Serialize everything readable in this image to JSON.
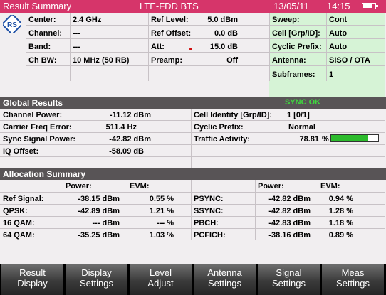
{
  "header": {
    "title": "Result Summary",
    "mode": "LTE-FDD BTS",
    "date": "13/05/11",
    "time": "14:15"
  },
  "settings": {
    "center_label": "Center:",
    "center_value": "2.4 GHz",
    "channel_label": "Channel:",
    "channel_value": "---",
    "band_label": "Band:",
    "band_value": "---",
    "chbw_label": "Ch BW:",
    "chbw_value": "10 MHz (50 RB)",
    "reflevel_label": "Ref Level:",
    "reflevel_value": "5.0 dBm",
    "refoffset_label": "Ref Offset:",
    "refoffset_value": "0.0 dB",
    "att_label": "Att:",
    "att_value": "15.0 dB",
    "preamp_label": "Preamp:",
    "preamp_value": "Off",
    "sweep_label": "Sweep:",
    "sweep_value": "Cont",
    "cell_label": "Cell [Grp/ID]:",
    "cell_value": "Auto",
    "cp_label": "Cyclic Prefix:",
    "cp_value": "Auto",
    "antenna_label": "Antenna:",
    "antenna_value": "SISO / OTA",
    "subframes_label": "Subframes:",
    "subframes_value": "1"
  },
  "global": {
    "heading": "Global Results",
    "sync_status": "SYNC OK",
    "channel_power_label": "Channel Power:",
    "channel_power_value": "-11.12 dBm",
    "carrier_freq_label": "Carrier Freq Error:",
    "carrier_freq_value": "511.4 Hz",
    "sync_signal_label": "Sync Signal Power:",
    "sync_signal_value": "-42.82 dBm",
    "iq_offset_label": "IQ Offset:",
    "iq_offset_value": "-58.09 dB",
    "cell_identity_label": "Cell Identity [Grp/ID]:",
    "cell_identity_value": "1  [0/1]",
    "cyclic_prefix_label": "Cyclic Prefix:",
    "cyclic_prefix_value": "Normal",
    "traffic_label": "Traffic Activity:",
    "traffic_value": "78.81",
    "traffic_unit": "%",
    "traffic_percent": 78.81
  },
  "allocation": {
    "heading": "Allocation Summary",
    "col_power": "Power:",
    "col_evm": "EVM:",
    "left_rows": [
      {
        "name": "Ref Signal:",
        "power": "-38.15 dBm",
        "evm": "0.55 %"
      },
      {
        "name": "QPSK:",
        "power": "-42.89 dBm",
        "evm": "1.21 %"
      },
      {
        "name": "16 QAM:",
        "power": "--- dBm",
        "evm": "--- %"
      },
      {
        "name": "64 QAM:",
        "power": "-35.25 dBm",
        "evm": "1.03 %"
      }
    ],
    "right_rows": [
      {
        "name": "PSYNC:",
        "power": "-42.82 dBm",
        "evm": "0.94 %"
      },
      {
        "name": "SSYNC:",
        "power": "-42.82 dBm",
        "evm": "1.28 %"
      },
      {
        "name": "PBCH:",
        "power": "-42.83 dBm",
        "evm": "1.18 %"
      },
      {
        "name": "PCFICH:",
        "power": "-38.16 dBm",
        "evm": "0.89 %"
      }
    ]
  },
  "softkeys": [
    {
      "line1": "Result",
      "line2": "Display"
    },
    {
      "line1": "Display",
      "line2": "Settings"
    },
    {
      "line1": "Level",
      "line2": "Adjust"
    },
    {
      "line1": "Antenna",
      "line2": "Settings"
    },
    {
      "line1": "Signal",
      "line2": "Settings"
    },
    {
      "line1": "Meas",
      "line2": "Settings"
    }
  ],
  "colors": {
    "title_bar": "#d6356a",
    "section_bar": "#585456",
    "sync_ok": "#3fd63f",
    "traffic_bar": "#2dbb2d"
  }
}
